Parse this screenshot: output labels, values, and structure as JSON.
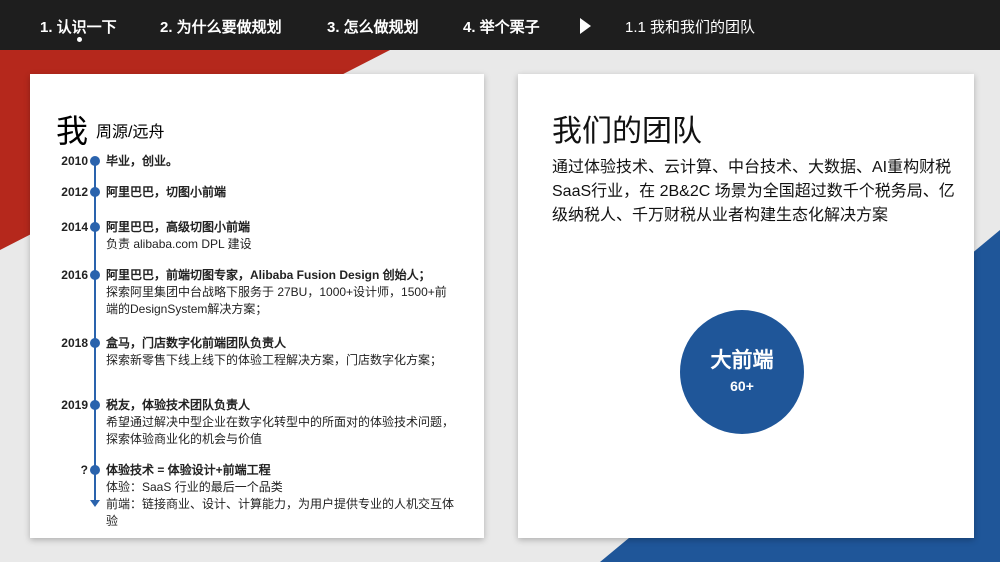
{
  "nav": {
    "items": [
      "1. 认识一下",
      "2. 为什么要做规划",
      "3. 怎么做规划",
      "4. 举个栗子"
    ],
    "current": "1.1 我和我们的团队"
  },
  "left": {
    "me": "我",
    "name": "周源/远舟",
    "timeline": [
      {
        "year": "2010",
        "title": "毕业，创业。",
        "lines": []
      },
      {
        "year": "2012",
        "title": "阿里巴巴，切图小前端",
        "lines": []
      },
      {
        "year": "2014",
        "title": "阿里巴巴，高级切图小前端",
        "lines": [
          "负责 alibaba.com DPL 建设"
        ]
      },
      {
        "year": "2016",
        "title": "阿里巴巴，前端切图专家，Alibaba Fusion Design 创始人；",
        "lines": [
          "探索阿里集团中台战略下服务于 27BU，1000+设计师，1500+前端的DesignSystem解决方案；"
        ]
      },
      {
        "year": "2018",
        "title": "盒马，门店数字化前端团队负责人",
        "lines": [
          "探索新零售下线上线下的体验工程解决方案，门店数字化方案；"
        ]
      },
      {
        "year": "2019",
        "title": "税友，体验技术团队负责人",
        "lines": [
          "希望通过解决中型企业在数字化转型中的所面对的体验技术问题，探索体验商业化的机会与价值"
        ]
      },
      {
        "year": "?",
        "title": "体验技术 = 体验设计+前端工程",
        "lines": [
          "体验：SaaS 行业的最后一个品类",
          "前端：链接商业、设计、计算能力，为用户提供专业的人机交互体验"
        ]
      }
    ]
  },
  "right": {
    "title": "我们的团队",
    "desc": "通过体验技术、云计算、中台技术、大数据、AI重构财税SaaS行业，在 2B&2C 场景为全国超过数千个税务局、亿级纳税人、千万财税从业者构建生态化解决方案",
    "circle_label": "大前端",
    "circle_count": "60+"
  },
  "colors": {
    "accent": "#1f5699",
    "red": "#b5281c"
  }
}
